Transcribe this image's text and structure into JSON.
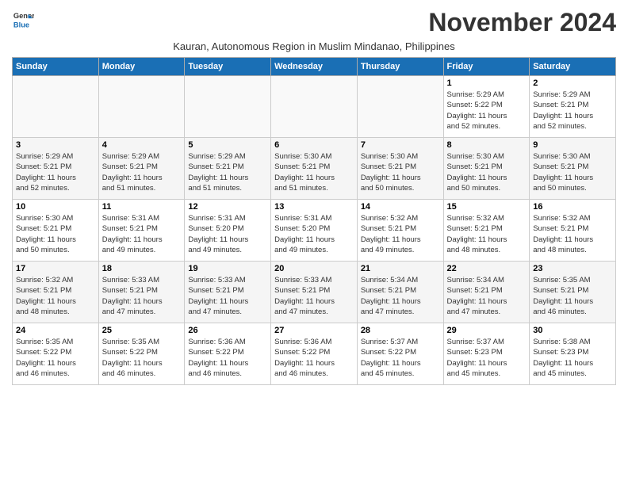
{
  "header": {
    "logo_line1": "General",
    "logo_line2": "Blue",
    "month_title": "November 2024",
    "subtitle": "Kauran, Autonomous Region in Muslim Mindanao, Philippines"
  },
  "columns": [
    "Sunday",
    "Monday",
    "Tuesday",
    "Wednesday",
    "Thursday",
    "Friday",
    "Saturday"
  ],
  "weeks": [
    [
      {
        "day": "",
        "info": ""
      },
      {
        "day": "",
        "info": ""
      },
      {
        "day": "",
        "info": ""
      },
      {
        "day": "",
        "info": ""
      },
      {
        "day": "",
        "info": ""
      },
      {
        "day": "1",
        "info": "Sunrise: 5:29 AM\nSunset: 5:22 PM\nDaylight: 11 hours\nand 52 minutes."
      },
      {
        "day": "2",
        "info": "Sunrise: 5:29 AM\nSunset: 5:21 PM\nDaylight: 11 hours\nand 52 minutes."
      }
    ],
    [
      {
        "day": "3",
        "info": "Sunrise: 5:29 AM\nSunset: 5:21 PM\nDaylight: 11 hours\nand 52 minutes."
      },
      {
        "day": "4",
        "info": "Sunrise: 5:29 AM\nSunset: 5:21 PM\nDaylight: 11 hours\nand 51 minutes."
      },
      {
        "day": "5",
        "info": "Sunrise: 5:29 AM\nSunset: 5:21 PM\nDaylight: 11 hours\nand 51 minutes."
      },
      {
        "day": "6",
        "info": "Sunrise: 5:30 AM\nSunset: 5:21 PM\nDaylight: 11 hours\nand 51 minutes."
      },
      {
        "day": "7",
        "info": "Sunrise: 5:30 AM\nSunset: 5:21 PM\nDaylight: 11 hours\nand 50 minutes."
      },
      {
        "day": "8",
        "info": "Sunrise: 5:30 AM\nSunset: 5:21 PM\nDaylight: 11 hours\nand 50 minutes."
      },
      {
        "day": "9",
        "info": "Sunrise: 5:30 AM\nSunset: 5:21 PM\nDaylight: 11 hours\nand 50 minutes."
      }
    ],
    [
      {
        "day": "10",
        "info": "Sunrise: 5:30 AM\nSunset: 5:21 PM\nDaylight: 11 hours\nand 50 minutes."
      },
      {
        "day": "11",
        "info": "Sunrise: 5:31 AM\nSunset: 5:21 PM\nDaylight: 11 hours\nand 49 minutes."
      },
      {
        "day": "12",
        "info": "Sunrise: 5:31 AM\nSunset: 5:20 PM\nDaylight: 11 hours\nand 49 minutes."
      },
      {
        "day": "13",
        "info": "Sunrise: 5:31 AM\nSunset: 5:20 PM\nDaylight: 11 hours\nand 49 minutes."
      },
      {
        "day": "14",
        "info": "Sunrise: 5:32 AM\nSunset: 5:21 PM\nDaylight: 11 hours\nand 49 minutes."
      },
      {
        "day": "15",
        "info": "Sunrise: 5:32 AM\nSunset: 5:21 PM\nDaylight: 11 hours\nand 48 minutes."
      },
      {
        "day": "16",
        "info": "Sunrise: 5:32 AM\nSunset: 5:21 PM\nDaylight: 11 hours\nand 48 minutes."
      }
    ],
    [
      {
        "day": "17",
        "info": "Sunrise: 5:32 AM\nSunset: 5:21 PM\nDaylight: 11 hours\nand 48 minutes."
      },
      {
        "day": "18",
        "info": "Sunrise: 5:33 AM\nSunset: 5:21 PM\nDaylight: 11 hours\nand 47 minutes."
      },
      {
        "day": "19",
        "info": "Sunrise: 5:33 AM\nSunset: 5:21 PM\nDaylight: 11 hours\nand 47 minutes."
      },
      {
        "day": "20",
        "info": "Sunrise: 5:33 AM\nSunset: 5:21 PM\nDaylight: 11 hours\nand 47 minutes."
      },
      {
        "day": "21",
        "info": "Sunrise: 5:34 AM\nSunset: 5:21 PM\nDaylight: 11 hours\nand 47 minutes."
      },
      {
        "day": "22",
        "info": "Sunrise: 5:34 AM\nSunset: 5:21 PM\nDaylight: 11 hours\nand 47 minutes."
      },
      {
        "day": "23",
        "info": "Sunrise: 5:35 AM\nSunset: 5:21 PM\nDaylight: 11 hours\nand 46 minutes."
      }
    ],
    [
      {
        "day": "24",
        "info": "Sunrise: 5:35 AM\nSunset: 5:22 PM\nDaylight: 11 hours\nand 46 minutes."
      },
      {
        "day": "25",
        "info": "Sunrise: 5:35 AM\nSunset: 5:22 PM\nDaylight: 11 hours\nand 46 minutes."
      },
      {
        "day": "26",
        "info": "Sunrise: 5:36 AM\nSunset: 5:22 PM\nDaylight: 11 hours\nand 46 minutes."
      },
      {
        "day": "27",
        "info": "Sunrise: 5:36 AM\nSunset: 5:22 PM\nDaylight: 11 hours\nand 46 minutes."
      },
      {
        "day": "28",
        "info": "Sunrise: 5:37 AM\nSunset: 5:22 PM\nDaylight: 11 hours\nand 45 minutes."
      },
      {
        "day": "29",
        "info": "Sunrise: 5:37 AM\nSunset: 5:23 PM\nDaylight: 11 hours\nand 45 minutes."
      },
      {
        "day": "30",
        "info": "Sunrise: 5:38 AM\nSunset: 5:23 PM\nDaylight: 11 hours\nand 45 minutes."
      }
    ]
  ]
}
